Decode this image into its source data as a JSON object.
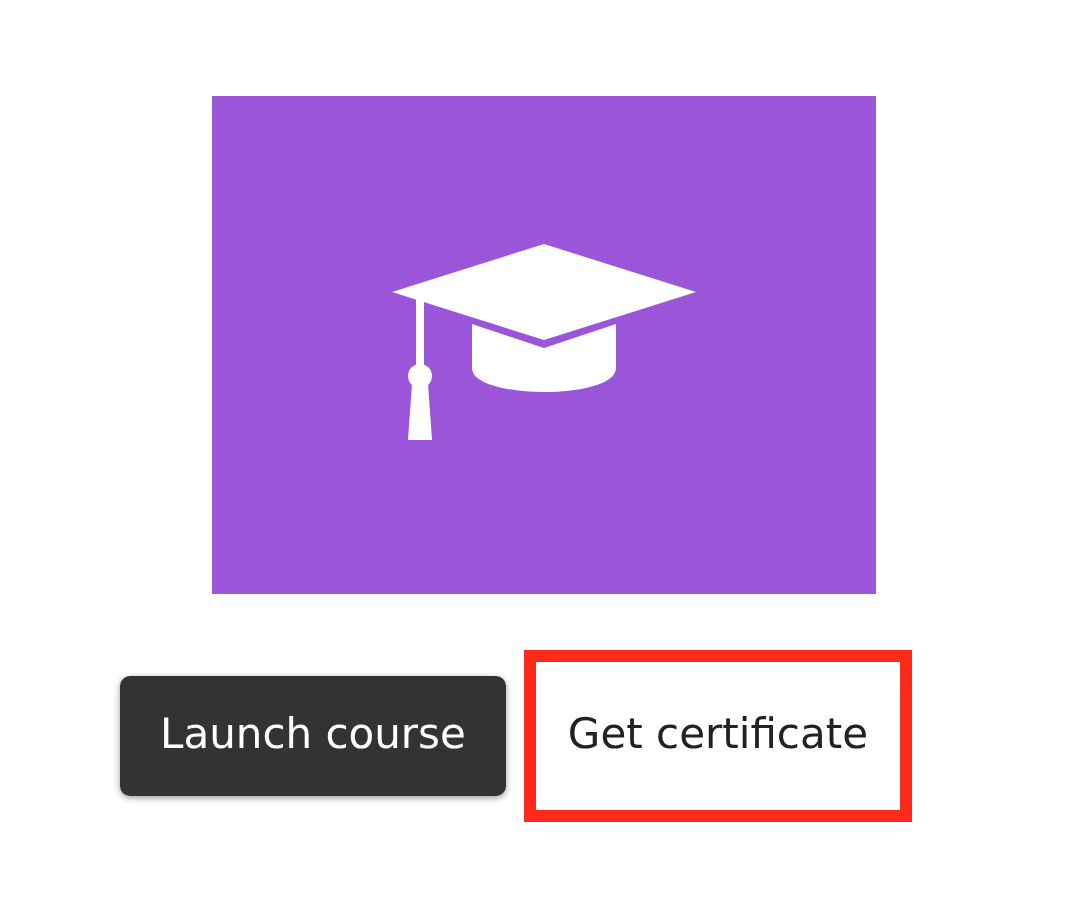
{
  "buttons": [
    {
      "label": "Launch course",
      "kind": "primary",
      "highlighted": false
    },
    {
      "label": "Get certificate",
      "kind": "secondary",
      "highlighted": true
    }
  ]
}
